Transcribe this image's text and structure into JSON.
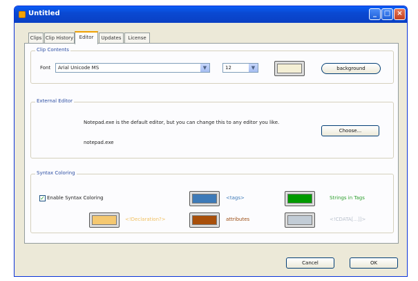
{
  "window": {
    "title": "Untitled",
    "controls": {
      "minimize": "_",
      "maximize": "□",
      "close": "×"
    }
  },
  "tabs": [
    {
      "label": "Clips"
    },
    {
      "label": "Clip History"
    },
    {
      "label": "Editor"
    },
    {
      "label": "Updates"
    },
    {
      "label": "License"
    }
  ],
  "clip_contents": {
    "legend": "Clip Contents",
    "font_label": "Font",
    "font_value": "Arial Unicode MS",
    "size_value": "12",
    "swatch_color": "#f4efd5",
    "background_label": "background"
  },
  "external_editor": {
    "legend": "External Editor",
    "description": "Notepad.exe is the default editor, but you can change this to any editor you like.",
    "current_editor": "notepad.exe",
    "choose_label": "Choose..."
  },
  "syntax": {
    "legend": "Syntax Coloring",
    "enable_label": "Enable Syntax Coloring",
    "enabled": true,
    "items": [
      {
        "label": "<tags>",
        "swatch": "#3d7ab8",
        "text_color": "#3d7ab8"
      },
      {
        "label": "Strings in Tags",
        "swatch": "#009a00",
        "text_color": "#2ea02e"
      },
      {
        "label": "<!Declaration?>",
        "swatch": "#f5c870",
        "text_color": "#f0c060"
      },
      {
        "label": "attributes",
        "swatch": "#a84f0a",
        "text_color": "#9a4a10"
      },
      {
        "label": "<!CDATA[...]]>",
        "swatch": "#c2ccd6",
        "text_color": "#b8c0cc"
      }
    ]
  },
  "footer": {
    "cancel_label": "Cancel",
    "ok_label": "OK"
  }
}
